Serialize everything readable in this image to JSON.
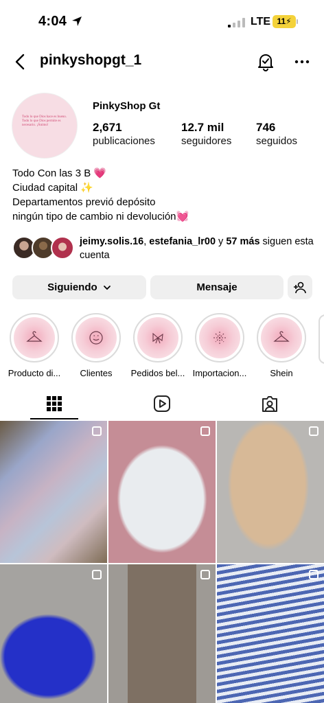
{
  "status_bar": {
    "time": "4:04",
    "network": "LTE",
    "battery": "11"
  },
  "header": {
    "username": "pinkyshopgt_1"
  },
  "profile": {
    "display_name": "PinkyShop Gt",
    "avatar_text": "Todo lo que Dios hace es bueno. Todo lo que Dios permite es necesario. ¡Ánimo!",
    "stats": [
      {
        "value": "2,671",
        "label": "publicaciones"
      },
      {
        "value": "12.7 mil",
        "label": "seguidores"
      },
      {
        "value": "746",
        "label": "seguidos"
      }
    ],
    "bio": [
      "Todo Con las 3 B 💗",
      "Ciudad capital ✨",
      "Departamentos previó depósito",
      "ningún tipo de cambio ni devolución💓"
    ]
  },
  "followed_by": {
    "user1": "jeimy.solis.16",
    "sep": ", ",
    "user2": "estefania_lr00",
    "and": " y ",
    "more": "57 más",
    "suffix": " siguen esta cuenta"
  },
  "actions": {
    "following": "Siguiendo",
    "message": "Mensaje"
  },
  "highlights": [
    {
      "label": "Producto di...",
      "icon": "hanger-icon"
    },
    {
      "label": "Clientes",
      "icon": "smile-icon"
    },
    {
      "label": "Pedidos bel...",
      "icon": "bow-icon"
    },
    {
      "label": "Importacion...",
      "icon": "sparkle-icon"
    },
    {
      "label": "Shein",
      "icon": "hanger-icon"
    }
  ],
  "tabs": [
    "grid-icon",
    "reels-icon",
    "tagged-icon"
  ],
  "colors": {
    "accent_pink": "#f2a9bb",
    "button_bg": "#efefef",
    "battery": "#f4d23a"
  }
}
